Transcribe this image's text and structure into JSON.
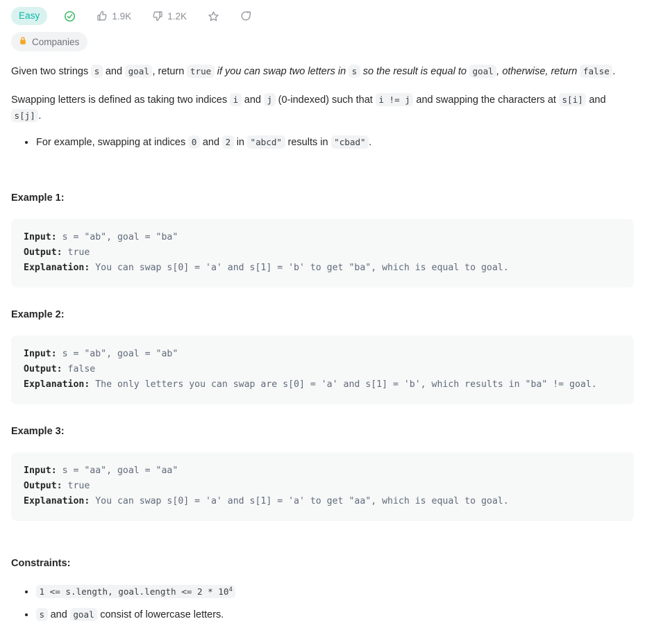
{
  "header": {
    "difficulty": "Easy",
    "solved_icon": "check-circle-icon",
    "likes": {
      "icon": "thumbs-up-icon",
      "count": "1.9K"
    },
    "dislikes": {
      "icon": "thumbs-down-icon",
      "count": "1.2K"
    },
    "favorite_icon": "star-icon",
    "share_icon": "share-icon",
    "companies_pill": {
      "icon": "lock-icon",
      "label": "Companies"
    },
    "colors": {
      "difficulty_text": "#0bb7a8",
      "difficulty_bg": "#d9f2ef",
      "solved_green": "#2db55d",
      "lock_orange": "#f5a623",
      "icon_gray": "#8a8f95"
    }
  },
  "description": {
    "p1": {
      "t1": "Given two strings ",
      "c1": "s",
      "t2": " and ",
      "c2": "goal",
      "t3": ", return ",
      "c3": "true",
      "em1": " if you can swap two letters in ",
      "c4": "s",
      "em2": " so the result is equal to ",
      "c5": "goal",
      "em3": ", otherwise, return ",
      "c6": "false",
      "t4": "."
    },
    "p2": {
      "t1": "Swapping letters is defined as taking two indices ",
      "c1": "i",
      "t2": " and ",
      "c2": "j",
      "t3": " (0-indexed) such that ",
      "c3": "i != j",
      "t4": " and swapping the characters at ",
      "c4": "s[i]",
      "t5": " and ",
      "c5": "s[j]",
      "t6": "."
    },
    "bullet1": {
      "t1": "For example, swapping at indices ",
      "c1": "0",
      "t2": " and ",
      "c2": "2",
      "t3": " in ",
      "c3": "\"abcd\"",
      "t4": " results in ",
      "c4": "\"cbad\"",
      "t5": "."
    }
  },
  "examples": [
    {
      "title": "Example 1:",
      "input_label": "Input:",
      "input_value": " s = \"ab\", goal = \"ba\"",
      "output_label": "Output:",
      "output_value": " true",
      "explanation_label": "Explanation:",
      "explanation_value": " You can swap s[0] = 'a' and s[1] = 'b' to get \"ba\", which is equal to goal."
    },
    {
      "title": "Example 2:",
      "input_label": "Input:",
      "input_value": " s = \"ab\", goal = \"ab\"",
      "output_label": "Output:",
      "output_value": " false",
      "explanation_label": "Explanation:",
      "explanation_value": " The only letters you can swap are s[0] = 'a' and s[1] = 'b', which results in \"ba\" != goal."
    },
    {
      "title": "Example 3:",
      "input_label": "Input:",
      "input_value": " s = \"aa\", goal = \"aa\"",
      "output_label": "Output:",
      "output_value": " true",
      "explanation_label": "Explanation:",
      "explanation_value": " You can swap s[0] = 'a' and s[1] = 'a' to get \"aa\", which is equal to goal."
    }
  ],
  "constraints": {
    "title": "Constraints:",
    "item1": {
      "code_main": "1 <= s.length, goal.length <= 2 * 10",
      "code_sup": "4"
    },
    "item2": {
      "c1": "s",
      "t1": " and ",
      "c2": "goal",
      "t2": " consist of lowercase letters."
    }
  }
}
